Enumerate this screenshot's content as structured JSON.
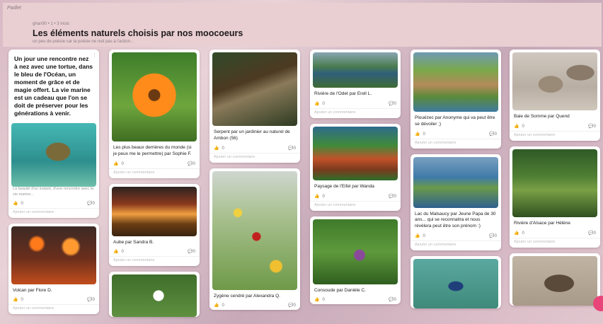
{
  "header": {
    "brand": "Padlet",
    "meta": "ghan90 • 1 • 3 mois",
    "title": "Les éléments naturels choisis par nos moocoeurs",
    "subtitle": "un peu de poésie car la poésie ne nuit pas à l'action..."
  },
  "common": {
    "comment_placeholder": "Ajouter un commentaire",
    "like_count": "0",
    "comment_count": "0"
  },
  "col1": {
    "intro_text": "Un jour une rencontre nez à nez avec une tortue, dans le bleu de l'Océan, un moment de grâce et de magie offert. La vie marine est un cadeau que l'on se doit de préserver pour les générations à venir.",
    "turtle_desc": "La beauté d'un instant, d'une rencontre avec la vie marine...",
    "volcano_caption": "Volcan par Flore D."
  },
  "col2": {
    "flower_caption": "Les plus beaux derrières du monde (si je peux me le permettre) par Sophie F.",
    "sunrise_caption": "Aube par Sandra B."
  },
  "col3": {
    "snake_caption": "Serpent par un jardinier au naturel de Ambon (56)",
    "moth_caption": "Zygène cendré par Alexandra Q."
  },
  "col4": {
    "river_caption": "Rivière de l'Odet par Erell L.",
    "painting_caption": "Paysage de l'Eifel par Wanda",
    "consoude_caption": "Consoude par Danièle C."
  },
  "col5": {
    "aerial_caption": "Plouézec par Anonyme qui va peut être se dévoiler ;)",
    "lake_caption": "Lac du Malsaucy par Jeune Papa de 30 ans... qui se reconnaitra et nous révèlera peut être son prénom :)"
  },
  "col6": {
    "seals_caption": "Baie de Somme par Quend",
    "forest_caption": "Rivière d'Alsace par Hélène"
  }
}
